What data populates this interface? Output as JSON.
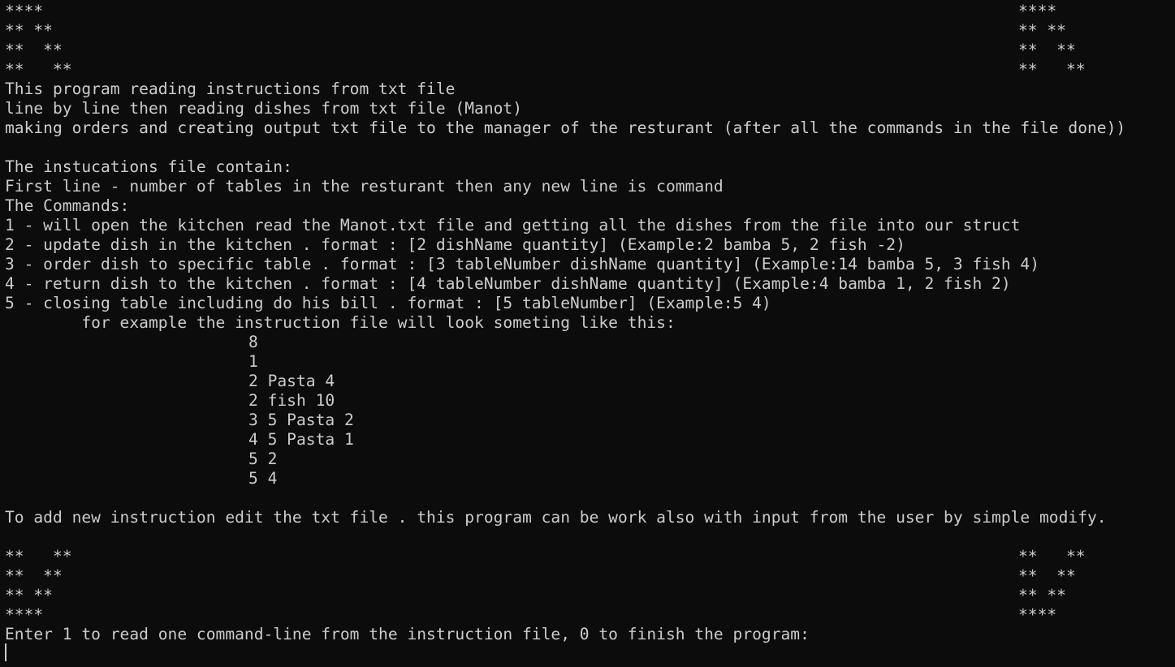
{
  "banner_top": {
    "left": [
      "****",
      "** **",
      "**  **",
      "**   **"
    ],
    "right": [
      "****",
      "** **",
      "**  **",
      "**   **"
    ]
  },
  "intro": [
    "This program reading instructions from txt file",
    "line by line then reading dishes from txt file (Manot)",
    "making orders and creating output txt file to the manager of the resturant (after all the commands in the file done))"
  ],
  "file_desc": {
    "heading": "The instucations file contain:",
    "first_line": "First line - number of tables in the resturant then any new line is command",
    "commands_heading": "The Commands:",
    "commands": [
      "1 - will open the kitchen read the Manot.txt file and getting all the dishes from the file into our struct",
      "2 - update dish in the kitchen . format : [2 dishName quantity] (Example:2 bamba 5, 2 fish -2)",
      "3 - order dish to specific table . format : [3 tableNumber dishName quantity] (Example:14 bamba 5, 3 fish 4)",
      "4 - return dish to the kitchen . format : [4 tableNumber dishName quantity] (Example:4 bamba 1, 2 fish 2)",
      "5 - closing table including do his bill . format : [5 tableNumber] (Example:5 4)"
    ],
    "example_intro": "        for example the instruction file will look someting like this:",
    "example_lines": [
      "8",
      "1",
      "2 Pasta 4",
      "2 fish 10",
      "3 5 Pasta 2",
      "4 5 Pasta 1",
      "5 2",
      "5 4"
    ]
  },
  "add_note": "To add new instruction edit the txt file . this program can be work also with input from the user by simple modify.",
  "banner_bottom": {
    "left": [
      "**   **",
      "**  **",
      "** **",
      "****"
    ],
    "right": [
      "**   **",
      "**  **",
      "** **",
      "****"
    ]
  },
  "prompt": "Enter 1 to read one command-line from the instruction file, 0 to finish the program:"
}
